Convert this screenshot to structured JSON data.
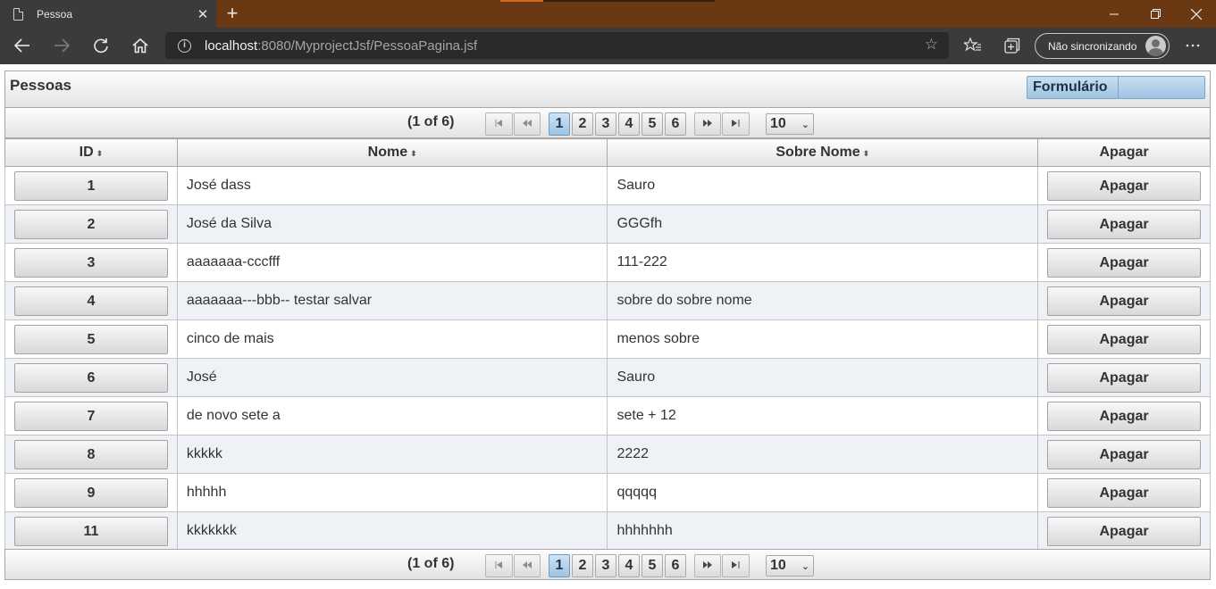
{
  "browser": {
    "tab_title": "Pessoa",
    "close_glyph": "✕",
    "new_tab_glyph": "+",
    "url_host": "localhost",
    "url_path": ":8080/MyprojectJsf/PessoaPagina.jsf",
    "profile_label": "Não sincronizando",
    "icons": [
      "back-icon",
      "forward-icon",
      "refresh-icon",
      "home-icon",
      "info-icon",
      "star-icon",
      "favorites-icon",
      "collections-icon",
      "more-icon"
    ]
  },
  "panel": {
    "title": "Pessoas",
    "form_button": "Formulário"
  },
  "paginator": {
    "current": "(1 of 6)",
    "pages": [
      "1",
      "2",
      "3",
      "4",
      "5",
      "6"
    ],
    "selected_page": "1",
    "rows_per_page": "10"
  },
  "table": {
    "headers": [
      "ID",
      "Nome",
      "Sobre Nome",
      "Apagar"
    ],
    "rows": [
      {
        "id": "1",
        "nome": "José dass",
        "sobrenome": "Sauro",
        "action": "Apagar"
      },
      {
        "id": "2",
        "nome": "José da Silva",
        "sobrenome": "GGGfh",
        "action": "Apagar"
      },
      {
        "id": "3",
        "nome": "aaaaaaa-cccfff",
        "sobrenome": "111-222",
        "action": "Apagar"
      },
      {
        "id": "4",
        "nome": "aaaaaaa---bbb-- testar salvar",
        "sobrenome": "sobre do sobre nome",
        "action": "Apagar"
      },
      {
        "id": "5",
        "nome": "cinco de mais",
        "sobrenome": "menos sobre",
        "action": "Apagar"
      },
      {
        "id": "6",
        "nome": "José",
        "sobrenome": "Sauro",
        "action": "Apagar"
      },
      {
        "id": "7",
        "nome": "de novo sete a",
        "sobrenome": "sete + 12",
        "action": "Apagar"
      },
      {
        "id": "8",
        "nome": "kkkkk",
        "sobrenome": "2222",
        "action": "Apagar"
      },
      {
        "id": "9",
        "nome": "hhhhh",
        "sobrenome": "qqqqq",
        "action": "Apagar"
      },
      {
        "id": "11",
        "nome": "kkkkkkk",
        "sobrenome": "hhhhhhh",
        "action": "Apagar"
      }
    ]
  }
}
